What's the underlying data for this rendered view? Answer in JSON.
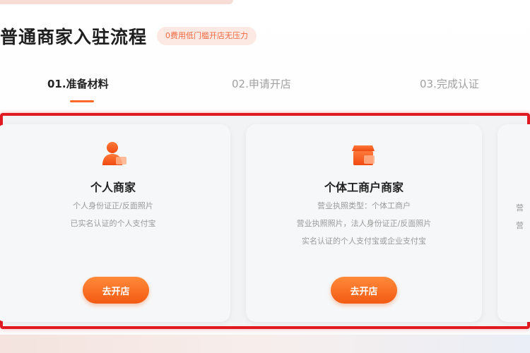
{
  "header": {
    "title": "普通商家入驻流程",
    "badge": "0费用低门槛开店无压力"
  },
  "steps": [
    {
      "label": "01.准备材料",
      "active": true
    },
    {
      "label": "02.申请开店",
      "active": false
    },
    {
      "label": "03.完成认证",
      "active": false
    }
  ],
  "cards": [
    {
      "icon": "person-icon",
      "title": "个人商家",
      "desc": [
        "个人身份证正/反面照片",
        "已实名认证的个人支付宝"
      ],
      "button": "去开店"
    },
    {
      "icon": "shop-icon",
      "title": "个体工商户商家",
      "desc": [
        "营业执照类型：个体工商户",
        "营业执照照片，法人身份证正/反面照片",
        "实名认证的个人支付宝或企业支付宝"
      ],
      "button": "去开店"
    },
    {
      "partial_text": [
        "营",
        "营"
      ]
    }
  ],
  "colors": {
    "accent": "#ff6a2b",
    "highlight_frame": "#e11a22",
    "badge_bg": "#fde9e3",
    "badge_text": "#f0683e"
  }
}
